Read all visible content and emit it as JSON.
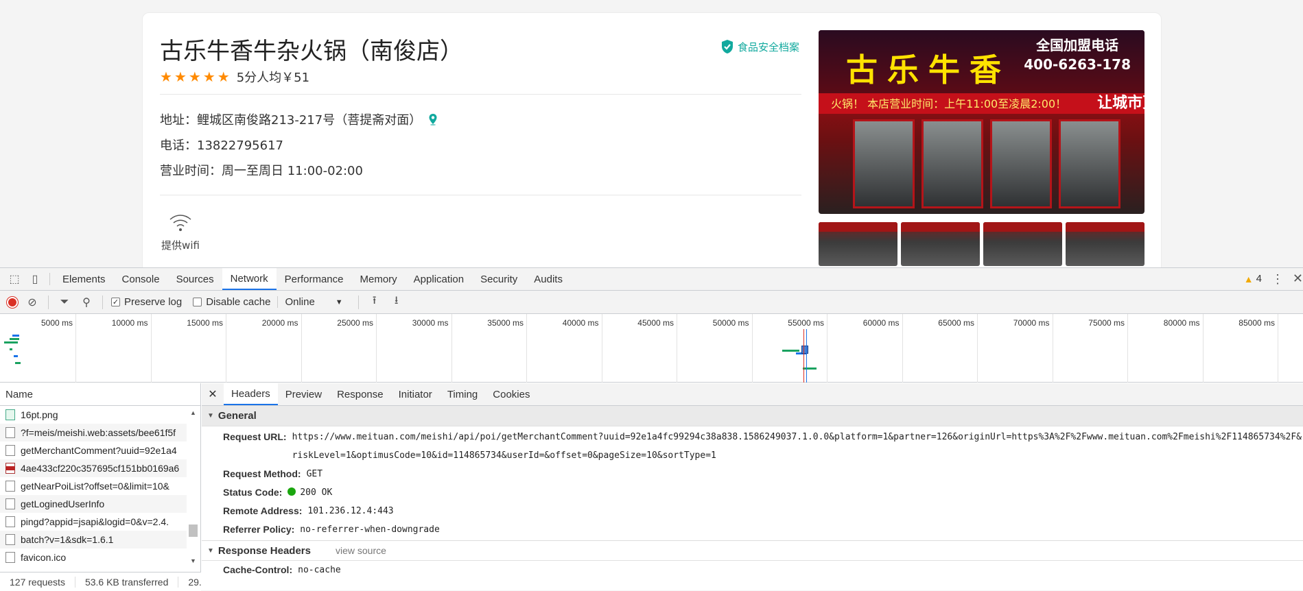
{
  "shop": {
    "title": "古乐牛香牛杂火锅（南俊店）",
    "safety_label": "食品安全档案",
    "stars": 5,
    "rating_text": "5分人均￥51",
    "address": "地址：鲤城区南俊路213-217号（菩提斋对面）",
    "phone": "电话：13822795617",
    "hours": "营业时间：周一至周日 11:00-02:00",
    "wifi_label": "提供wifi",
    "photo_sign": "古乐牛香",
    "photo_sub_1": "全国加盟电话",
    "photo_sub_2": "400-6263-178",
    "photo_banner": "火锅！ 本店营业时间：上午11:00至凌晨2:00！",
    "photo_banner_right": "让城市更美"
  },
  "devtools": {
    "tabs": [
      "Elements",
      "Console",
      "Sources",
      "Network",
      "Performance",
      "Memory",
      "Application",
      "Security",
      "Audits"
    ],
    "active_tab": "Network",
    "warning_count": "4",
    "toolbar": {
      "preserve_log": "Preserve log",
      "disable_cache": "Disable cache",
      "throttle": "Online"
    },
    "timeline_ticks": [
      "5000 ms",
      "10000 ms",
      "15000 ms",
      "20000 ms",
      "25000 ms",
      "30000 ms",
      "35000 ms",
      "40000 ms",
      "45000 ms",
      "50000 ms",
      "55000 ms",
      "60000 ms",
      "65000 ms",
      "70000 ms",
      "75000 ms",
      "80000 ms",
      "85000 ms"
    ],
    "name_header": "Name",
    "requests": [
      {
        "name": "16pt.png",
        "icon": "image"
      },
      {
        "name": "?f=meis/meishi.web:assets/bee61f5f",
        "icon": "doc"
      },
      {
        "name": "getMerchantComment?uuid=92e1a4",
        "icon": "doc"
      },
      {
        "name": "4ae433cf220c357695cf151bb0169a6",
        "icon": "red"
      },
      {
        "name": "getNearPoiList?offset=0&limit=10&",
        "icon": "doc"
      },
      {
        "name": "getLoginedUserInfo",
        "icon": "doc"
      },
      {
        "name": "pingd?appid=jsapi&logid=0&v=2.4.",
        "icon": "doc"
      },
      {
        "name": "batch?v=1&sdk=1.6.1",
        "icon": "doc"
      },
      {
        "name": "favicon.ico",
        "icon": "doc"
      }
    ],
    "status": {
      "requests": "127 requests",
      "transferred": "53.6 KB transferred",
      "extra": "29."
    },
    "detail_tabs": [
      "Headers",
      "Preview",
      "Response",
      "Initiator",
      "Timing",
      "Cookies"
    ],
    "active_detail_tab": "Headers",
    "general": {
      "title": "General",
      "request_url_key": "Request URL:",
      "request_url": "https://www.meituan.com/meishi/api/poi/getMerchantComment?uuid=92e1a4fc99294c38a838.1586249037.1.0.0&platform=1&partner=126&originUrl=https%3A%2F%2Fwww.meituan.com%2Fmeishi%2F114865734%2F&riskLevel=1&optimusCode=10&id=114865734&userId=&offset=0&pageSize=10&sortType=1",
      "method_key": "Request Method:",
      "method": "GET",
      "status_key": "Status Code:",
      "status": "200 OK",
      "remote_key": "Remote Address:",
      "remote": "101.236.12.4:443",
      "referrer_key": "Referrer Policy:",
      "referrer": "no-referrer-when-downgrade"
    },
    "response_headers": {
      "title": "Response Headers",
      "view_source": "view source",
      "cache_key": "Cache-Control:",
      "cache": "no-cache"
    }
  }
}
